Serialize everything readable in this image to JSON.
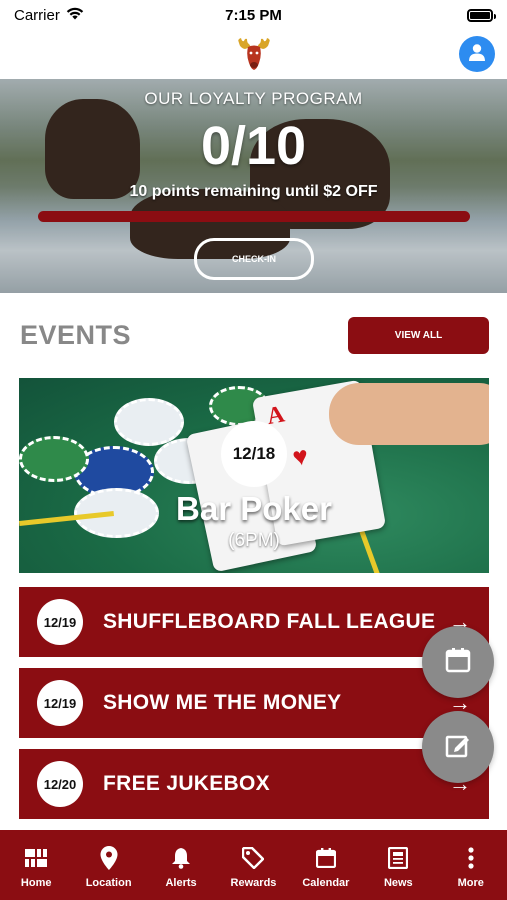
{
  "status_bar": {
    "carrier": "Carrier",
    "time": "7:15 PM"
  },
  "loyalty": {
    "title": "OUR LOYALTY PROGRAM",
    "points": "0/10",
    "progress": 0,
    "remaining_text": "10 points remaining until $2 OFF",
    "checkin_label": "CHECK-IN"
  },
  "events": {
    "title": "EVENTS",
    "view_all_label": "VIEW ALL",
    "featured": {
      "date": "12/18",
      "title": "Bar Poker",
      "time": "(6PM)"
    },
    "list": [
      {
        "date": "12/19",
        "name": "SHUFFLEBOARD FALL LEAGUE"
      },
      {
        "date": "12/19",
        "name": "SHOW ME THE MONEY"
      },
      {
        "date": "12/20",
        "name": "FREE JUKEBOX"
      }
    ]
  },
  "fabs": [
    {
      "icon": "calendar-icon"
    },
    {
      "icon": "edit-icon"
    }
  ],
  "tabs": [
    {
      "label": "Home",
      "icon": "home-grid-icon"
    },
    {
      "label": "Location",
      "icon": "location-pin-icon"
    },
    {
      "label": "Alerts",
      "icon": "bell-icon"
    },
    {
      "label": "Rewards",
      "icon": "tag-icon"
    },
    {
      "label": "Calendar",
      "icon": "calendar-icon"
    },
    {
      "label": "News",
      "icon": "newspaper-icon"
    },
    {
      "label": "More",
      "icon": "more-vertical-icon"
    }
  ],
  "colors": {
    "brand": "#8b0d12",
    "profile": "#2d8cf0",
    "fab": "#8a8a8a"
  }
}
